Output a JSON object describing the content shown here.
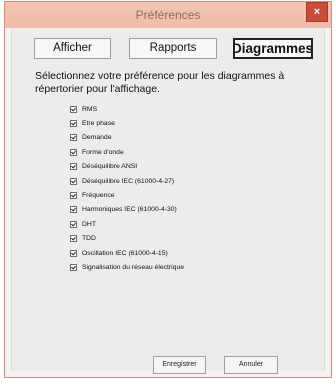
{
  "window": {
    "title": "Préférences",
    "close_glyph": "×"
  },
  "tabs": [
    {
      "label": "Afficher"
    },
    {
      "label": "Rapports"
    },
    {
      "label": "Diagrammes"
    }
  ],
  "instruction": "Sélectionnez votre préférence pour les diagrammes à répertorier pour l'affichage.",
  "options": [
    {
      "label": "RMS",
      "checked": true
    },
    {
      "label": "Etre phase",
      "checked": true
    },
    {
      "label": "Demande",
      "checked": true
    },
    {
      "label": "Forme d'onde",
      "checked": true
    },
    {
      "label": "Déséquilibre ANSI",
      "checked": true
    },
    {
      "label": "Déséquilibre IEC (61000-4-27)",
      "checked": true
    },
    {
      "label": "Fréquence",
      "checked": true
    },
    {
      "label": "Harmoniques IEC (61000-4-30)",
      "checked": true
    },
    {
      "label": "DHT",
      "checked": true
    },
    {
      "label": "TDD",
      "checked": true
    },
    {
      "label": "Oscillation IEC (61000-4-15)",
      "checked": true
    },
    {
      "label": "Signalisation du réseau électrique",
      "checked": true
    }
  ],
  "buttons": {
    "save_label": "Enregistrer",
    "cancel_label": "Annuler"
  },
  "colors": {
    "titlebar": "#f0c0ad",
    "close_button": "#c84b3b",
    "active_tab_border": "#222222"
  }
}
